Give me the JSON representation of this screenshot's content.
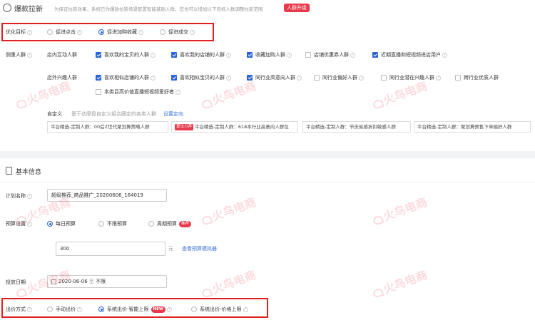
{
  "header": {
    "title": "爆款拉新",
    "desc": "为保证拉新效果，系统已为爆款拉新场景配置智能基础人群，您也可以增加以下目标人群调整拉新范围",
    "upgrade_label": "人群升级"
  },
  "optimize": {
    "label": "优化目标",
    "options": [
      "促进点击",
      "促进加购收藏",
      "促进成交"
    ],
    "selected": 1
  },
  "audience": {
    "label": "侧重人群",
    "instore_label": "店内互动人群",
    "instore_items": [
      {
        "label": "喜欢我的宝贝的人群",
        "checked": true
      },
      {
        "label": "喜欢我的店铺的人群",
        "checked": true
      },
      {
        "label": "收藏加购人群",
        "checked": true
      },
      {
        "label": "店铺优惠券人群",
        "checked": false
      },
      {
        "label": "近期直播和短视频进店用户",
        "checked": true
      }
    ],
    "outstore_label": "店外兴趣人群",
    "outstore_items": [
      {
        "label": "喜欢相似店铺的人群",
        "checked": true
      },
      {
        "label": "喜欢相似宝贝的人群",
        "checked": true
      },
      {
        "label": "同行业高意向人群",
        "checked": true
      },
      {
        "label": "同行业偏好人群",
        "checked": false
      },
      {
        "label": "同行业潜在兴趣人群",
        "checked": false
      },
      {
        "label": "跨行业优质人群",
        "checked": false
      },
      {
        "label": "本类目高价值直播短视频爱好者",
        "checked": false
      }
    ],
    "custom_label": "自定义",
    "custom_desc": "基于达摩盘自定义组合圈定的各类人群",
    "custom_link": "设置定向",
    "tags": [
      {
        "text": "平台精选-定制人群：00后Z世代聚划算策略人群",
        "hot": false
      },
      {
        "text": "平台精选-定制人群：618本行业高意向人群包",
        "hot": true,
        "hot_label": "算法力荐"
      },
      {
        "text": "平台精选-定制人群：节庆易感折扣敏感人群",
        "hot": false
      },
      {
        "text": "平台精选-定制人群：聚划算预售下单偏好人群",
        "hot": false
      }
    ]
  },
  "basic": {
    "title": "基本信息",
    "plan_label": "计划名称",
    "plan_value": "超级推荐_商品推广_20200606_164019",
    "budget_label": "预算设置",
    "budget_options": [
      "每日预算",
      "不限预算",
      "周期预算"
    ],
    "budget_selected": 0,
    "recommend_badge": "推荐",
    "budget_value": "300",
    "budget_unit": "元",
    "budget_link": "查看预算模拟器",
    "date_label": "投放日期",
    "date_start": "2020-06-06",
    "date_sep": "至",
    "date_end": "不限",
    "bid_label": "出价方式",
    "bid_options": [
      "手动出价",
      "系统出价-智能上限",
      "系统出价-价格上限"
    ],
    "bid_selected": 1,
    "new_badge": "NEW"
  },
  "watermark": {
    "text": "火鸟电商"
  },
  "colors": {
    "accent": "#2a63d8",
    "brand_red": "#e8384b",
    "highlight": "#e02020"
  }
}
